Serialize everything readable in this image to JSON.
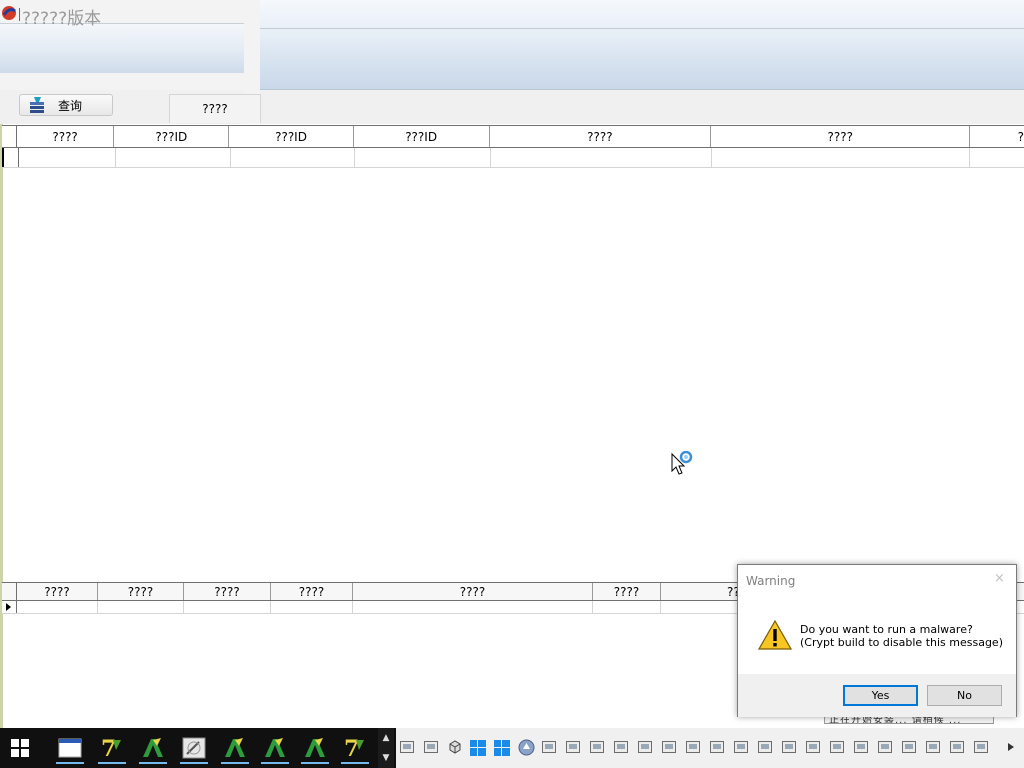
{
  "app": {
    "title": "?????版本"
  },
  "toolbar": {
    "query_label": "查询",
    "tab_label": "????"
  },
  "grid1": {
    "columns": [
      "????",
      "???ID",
      "???ID",
      "???ID",
      "????",
      "????",
      "?"
    ]
  },
  "grid2": {
    "columns": [
      "????",
      "????",
      "????",
      "????",
      "????",
      "????",
      "??"
    ]
  },
  "dialog": {
    "title": "Warning",
    "close": "×",
    "message_line1": "Do you want to run a malware?",
    "message_line2": "(Crypt build to disable this message)",
    "yes_label": "Yes",
    "no_label": "No"
  },
  "behind_window_text": "正在开始安装... 请稍候 ...",
  "taskbar": {
    "apps": [
      "window-app",
      "app-7z",
      "app-aurora",
      "app-tool",
      "app-aurora",
      "app-aurora",
      "app-aurora",
      "app-7z"
    ],
    "scroll_up": "▲",
    "scroll_down": "▼"
  },
  "colors": {
    "header_gradient_top": "#f5f8fc",
    "header_gradient_bottom": "#c9d8e9",
    "taskbar": "#101010",
    "accent": "#0078d7"
  }
}
